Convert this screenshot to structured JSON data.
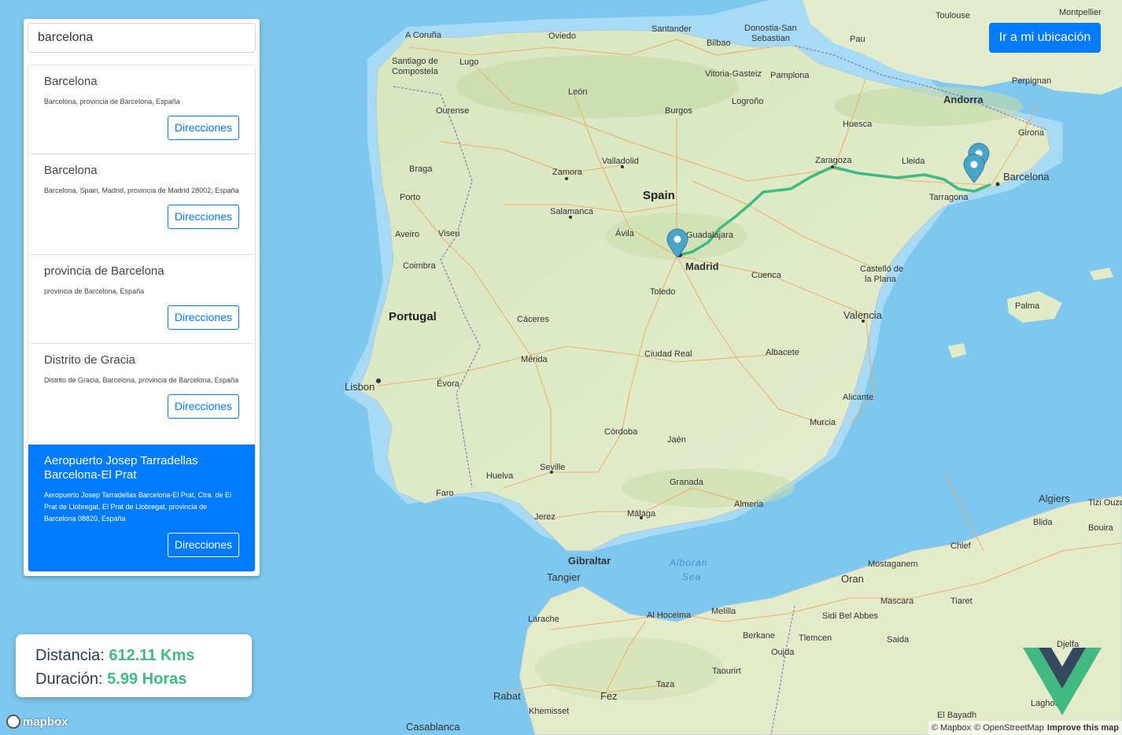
{
  "search": {
    "value": "barcelona"
  },
  "results": [
    {
      "title": "Barcelona",
      "address": "Barcelona, provincia de Barcelona, España",
      "button": "Direcciones",
      "active": false
    },
    {
      "title": "Barcelona",
      "address": "Barcelona, Spain, Madrid, provincia de Madrid 28002, España",
      "button": "Direcciones",
      "active": false
    },
    {
      "title": "provincia de Barcelona",
      "address": "provincia de Barcelona, España",
      "button": "Direcciones",
      "active": false
    },
    {
      "title": "Distrito de Gracia",
      "address": "Distrito de Gracia, Barcelona, provincia de Barcelona, España",
      "button": "Direcciones",
      "active": false
    },
    {
      "title": "Aeropuerto Josep Tarradellas Barcelona-El Prat",
      "address": "Aeropuerto Josep Tarradellas Barcelona-El Prat, Ctra. de El Prat de Llobregat, El Prat de Llobregat, provincia de Barcelona 08820, España",
      "button": "Direcciones",
      "active": true
    }
  ],
  "locate_button": "Ir a mi ubicación",
  "route": {
    "distance_label": "Distancia:",
    "distance_value": "612.11 Kms",
    "duration_label": "Duración:",
    "duration_value": "5.99 Horas"
  },
  "map": {
    "countries": [
      "Spain",
      "Portugal",
      "Andorra"
    ],
    "seas": [
      "Alboran",
      "Sea"
    ],
    "cities": [
      "A Coruña",
      "Oviedo",
      "Santander",
      "Donostia-San Sebastian",
      "Bilbao",
      "Pau",
      "Toulouse",
      "Montpellier",
      "Santiago de Compostela",
      "Lugo",
      "León",
      "Vitoria-Gasteiz",
      "Pamplona",
      "Perpignan",
      "Ourense",
      "Burgos",
      "Logroño",
      "Huesca",
      "Girona",
      "Braga",
      "Zamora",
      "Valladolid",
      "Zaragoza",
      "Lleida",
      "Barcelona",
      "Porto",
      "Tarragona",
      "Salamanca",
      "Aveiro",
      "Viseu",
      "Ávila",
      "Guadalajara",
      "Madrid",
      "Coimbra",
      "Cuenca",
      "Castelló de la Plana",
      "Toledo",
      "Palma",
      "Cáceres",
      "Valencia",
      "Ciudad Real",
      "Albacete",
      "Mérida",
      "Lisbon",
      "Évora",
      "Alicante",
      "Murcia",
      "Córdoba",
      "Jaén",
      "Seville",
      "Huelva",
      "Granada",
      "Faro",
      "Almeria",
      "Algiers",
      "Tizi Ouzou",
      "Jerez",
      "Málaga",
      "Blida",
      "Bouira",
      "Chlef",
      "Gibraltar",
      "Tangier",
      "Mostaganem",
      "Oran",
      "Tiaret",
      "Larache",
      "Al Hoceima",
      "Melilla",
      "Sidi Bel Abbes",
      "Mascara",
      "Berkane",
      "Tlemcen",
      "Saida",
      "Oujda",
      "Djelfa",
      "Taourirt",
      "Taza",
      "Rabat",
      "Fez",
      "Laghouat",
      "Khemisset",
      "El Bayadh",
      "Casablanca"
    ],
    "marker_color": "#4aa3c9",
    "route_color": "#42b983"
  },
  "attribution": {
    "mapbox_logo": "mapbox",
    "copyright_mapbox": "© Mapbox",
    "copyright_osm": "© OpenStreetMap",
    "improve": "Improve this map"
  },
  "colors": {
    "primary": "#007bff",
    "accent": "#42b983",
    "water": "#7ec8ef",
    "land": "#dfe9c8"
  }
}
